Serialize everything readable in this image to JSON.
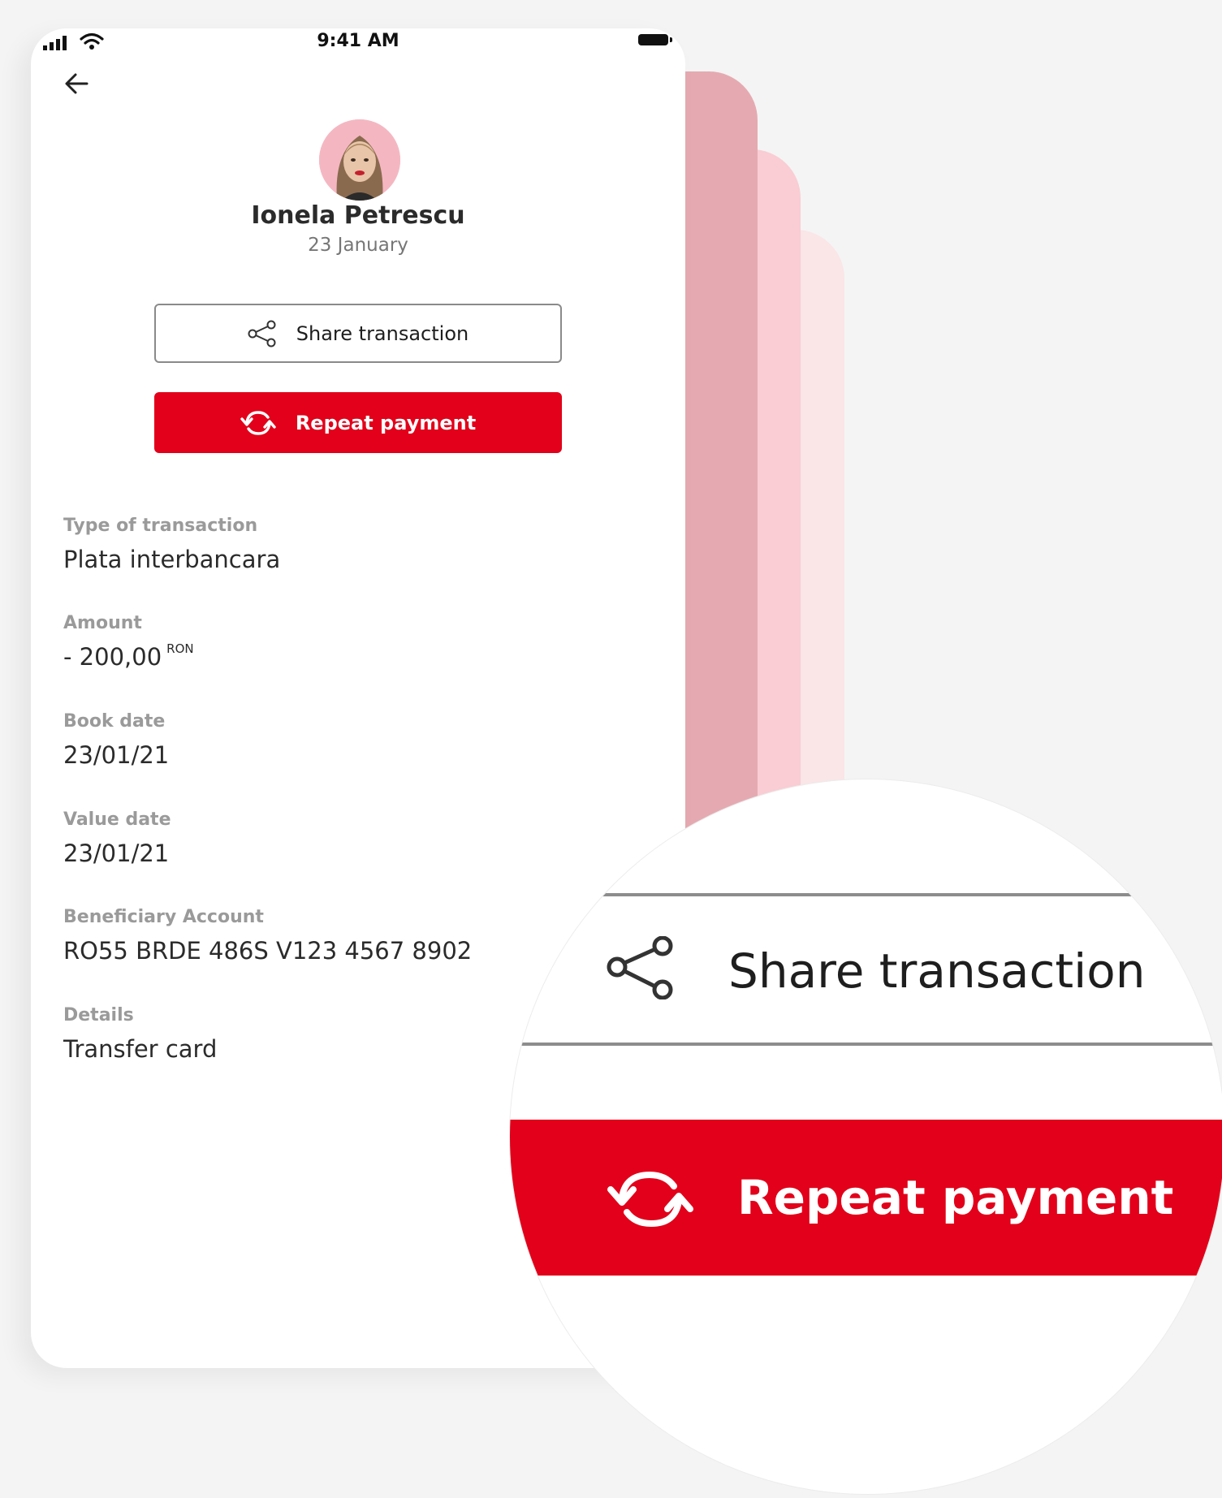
{
  "status_bar": {
    "time": "9:41 AM"
  },
  "contact": {
    "name": "Ionela Petrescu",
    "date": "23 January"
  },
  "actions": {
    "share_label": "Share transaction",
    "repeat_label": "Repeat payment"
  },
  "details": [
    {
      "label": "Type of transaction",
      "value": "Plata interbancara"
    },
    {
      "label": "Amount",
      "value": "- 200,00",
      "currency": "RON"
    },
    {
      "label": "Book date",
      "value": "23/01/21"
    },
    {
      "label": "Value date",
      "value": "23/01/21"
    },
    {
      "label": "Beneficiary Account",
      "value": "RO55 BRDE 486S V123 4567 8902"
    },
    {
      "label": "Details",
      "value": "Transfer card"
    }
  ],
  "magnifier": {
    "share_label": "Share transaction",
    "repeat_label": "Repeat payment"
  },
  "colors": {
    "brand_red": "#e2001a",
    "stack_1": "#e5aab1",
    "stack_2": "#f9cdd3",
    "stack_3": "#fae5e7"
  }
}
